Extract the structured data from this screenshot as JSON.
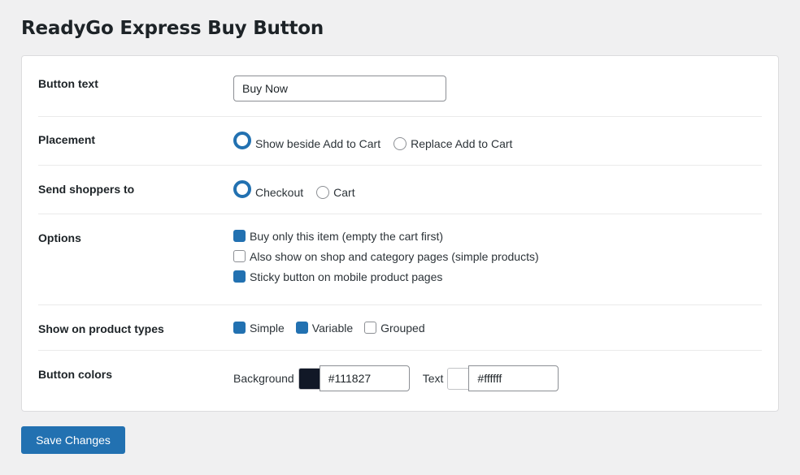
{
  "page": {
    "title": "ReadyGo Express Buy Button"
  },
  "settings": {
    "button_text": {
      "label": "Button text",
      "value": "Buy Now"
    },
    "placement": {
      "label": "Placement",
      "options": [
        {
          "label": "Show beside Add to Cart",
          "selected": true
        },
        {
          "label": "Replace Add to Cart",
          "selected": false
        }
      ]
    },
    "destination": {
      "label": "Send shoppers to",
      "options": [
        {
          "label": "Checkout",
          "selected": true
        },
        {
          "label": "Cart",
          "selected": false
        }
      ]
    },
    "options": {
      "label": "Options",
      "items": [
        {
          "label": "Buy only this item (empty the cart first)",
          "checked": true
        },
        {
          "label": "Also show on shop and category pages (simple products)",
          "checked": false
        },
        {
          "label": "Sticky button on mobile product pages",
          "checked": true
        }
      ]
    },
    "product_types": {
      "label": "Show on product types",
      "items": [
        {
          "label": "Simple",
          "checked": true
        },
        {
          "label": "Variable",
          "checked": true
        },
        {
          "label": "Grouped",
          "checked": false
        }
      ]
    },
    "colors": {
      "label": "Button colors",
      "background": {
        "label": "Background",
        "value": "#111827",
        "swatch": "#111827"
      },
      "text": {
        "label": "Text",
        "value": "#ffffff",
        "swatch": "#ffffff"
      }
    }
  },
  "footer": {
    "save_label": "Save Changes"
  },
  "theme": {
    "accent": "#2271b1",
    "panel_border": "#dcdcde",
    "page_bg": "#f0f0f1"
  }
}
